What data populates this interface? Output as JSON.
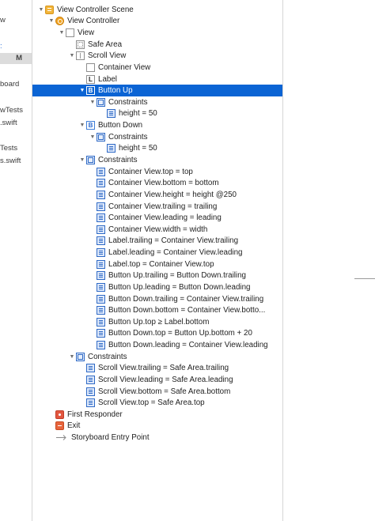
{
  "left_fragments": [
    "w",
    ":",
    "M",
    "board",
    "wTests",
    ".swift",
    "Tests",
    "s.swift"
  ],
  "rows": [
    {
      "label": "View Controller Scene",
      "depth": 0,
      "disc": "open",
      "icon": "scene",
      "icon_name": "scene-icon"
    },
    {
      "label": "View Controller",
      "depth": 1,
      "disc": "open",
      "icon": "vc",
      "icon_name": "view-controller-icon"
    },
    {
      "label": "View",
      "depth": 2,
      "disc": "open",
      "icon": "view",
      "icon_name": "view-icon"
    },
    {
      "label": "Safe Area",
      "depth": 3,
      "disc": "none",
      "icon": "safe",
      "icon_name": "safe-area-icon"
    },
    {
      "label": "Scroll View",
      "depth": 3,
      "disc": "open",
      "icon": "scroll",
      "icon_name": "scroll-view-icon"
    },
    {
      "label": "Container View",
      "depth": 4,
      "disc": "none",
      "icon": "view",
      "icon_name": "view-icon"
    },
    {
      "label": "Label",
      "depth": 4,
      "disc": "none",
      "icon": "label",
      "icon_name": "label-icon"
    },
    {
      "label": "Button Up",
      "depth": 4,
      "disc": "open",
      "icon": "button",
      "icon_name": "button-icon",
      "selected": true
    },
    {
      "label": "Constraints",
      "depth": 5,
      "disc": "open",
      "icon": "cgroup",
      "icon_name": "constraints-group-icon"
    },
    {
      "label": "height = 50",
      "depth": 6,
      "disc": "none",
      "icon": "cons",
      "icon_name": "constraint-icon"
    },
    {
      "label": "Button Down",
      "depth": 4,
      "disc": "open",
      "icon": "button",
      "icon_name": "button-icon"
    },
    {
      "label": "Constraints",
      "depth": 5,
      "disc": "open",
      "icon": "cgroup",
      "icon_name": "constraints-group-icon"
    },
    {
      "label": "height = 50",
      "depth": 6,
      "disc": "none",
      "icon": "cons",
      "icon_name": "constraint-icon"
    },
    {
      "label": "Constraints",
      "depth": 4,
      "disc": "open",
      "icon": "cgroup",
      "icon_name": "constraints-group-icon"
    },
    {
      "label": "Container View.top = top",
      "depth": 5,
      "disc": "none",
      "icon": "cons",
      "icon_name": "constraint-icon"
    },
    {
      "label": "Container View.bottom = bottom",
      "depth": 5,
      "disc": "none",
      "icon": "cons",
      "icon_name": "constraint-icon"
    },
    {
      "label": "Container View.height = height @250",
      "depth": 5,
      "disc": "none",
      "icon": "cons",
      "icon_name": "constraint-icon"
    },
    {
      "label": "Container View.trailing = trailing",
      "depth": 5,
      "disc": "none",
      "icon": "cons",
      "icon_name": "constraint-icon"
    },
    {
      "label": "Container View.leading = leading",
      "depth": 5,
      "disc": "none",
      "icon": "cons",
      "icon_name": "constraint-icon"
    },
    {
      "label": "Container View.width = width",
      "depth": 5,
      "disc": "none",
      "icon": "cons",
      "icon_name": "constraint-icon"
    },
    {
      "label": "Label.trailing = Container View.trailing",
      "depth": 5,
      "disc": "none",
      "icon": "cons",
      "icon_name": "constraint-icon"
    },
    {
      "label": "Label.leading = Container View.leading",
      "depth": 5,
      "disc": "none",
      "icon": "cons",
      "icon_name": "constraint-icon"
    },
    {
      "label": "Label.top = Container View.top",
      "depth": 5,
      "disc": "none",
      "icon": "cons",
      "icon_name": "constraint-icon"
    },
    {
      "label": "Button Up.trailing = Button Down.trailing",
      "depth": 5,
      "disc": "none",
      "icon": "cons",
      "icon_name": "constraint-icon"
    },
    {
      "label": "Button Up.leading = Button Down.leading",
      "depth": 5,
      "disc": "none",
      "icon": "cons",
      "icon_name": "constraint-icon"
    },
    {
      "label": "Button Down.trailing = Container View.trailing",
      "depth": 5,
      "disc": "none",
      "icon": "cons",
      "icon_name": "constraint-icon"
    },
    {
      "label": "Button Down.bottom = Container View.botto...",
      "depth": 5,
      "disc": "none",
      "icon": "cons",
      "icon_name": "constraint-icon"
    },
    {
      "label": "Button Up.top ≥ Label.bottom",
      "depth": 5,
      "disc": "none",
      "icon": "cons",
      "icon_name": "constraint-icon"
    },
    {
      "label": "Button Down.top = Button Up.bottom + 20",
      "depth": 5,
      "disc": "none",
      "icon": "cons",
      "icon_name": "constraint-icon"
    },
    {
      "label": "Button Down.leading = Container View.leading",
      "depth": 5,
      "disc": "none",
      "icon": "cons",
      "icon_name": "constraint-icon"
    },
    {
      "label": "Constraints",
      "depth": 3,
      "disc": "open",
      "icon": "cgroup",
      "icon_name": "constraints-group-icon"
    },
    {
      "label": "Scroll View.trailing = Safe Area.trailing",
      "depth": 4,
      "disc": "none",
      "icon": "cons",
      "icon_name": "constraint-icon"
    },
    {
      "label": "Scroll View.leading = Safe Area.leading",
      "depth": 4,
      "disc": "none",
      "icon": "cons",
      "icon_name": "constraint-icon"
    },
    {
      "label": "Scroll View.bottom = Safe Area.bottom",
      "depth": 4,
      "disc": "none",
      "icon": "cons",
      "icon_name": "constraint-icon"
    },
    {
      "label": "Scroll View.top = Safe Area.top",
      "depth": 4,
      "disc": "none",
      "icon": "cons",
      "icon_name": "constraint-icon"
    },
    {
      "label": "First Responder",
      "depth": 1,
      "disc": "none",
      "icon": "fr",
      "icon_name": "first-responder-icon"
    },
    {
      "label": "Exit",
      "depth": 1,
      "disc": "none",
      "icon": "exit",
      "icon_name": "exit-icon"
    },
    {
      "label": "Storyboard Entry Point",
      "depth": 1,
      "disc": "none",
      "icon": "entry",
      "icon_name": "entry-point-arrow-icon"
    }
  ],
  "colors": {
    "selection": "#0b64d4",
    "constraint_icon": "#2f6ac6",
    "vc_icon": "#f0a21f",
    "exit_icon": "#e7643c",
    "first_responder_icon": "#e2563f"
  }
}
